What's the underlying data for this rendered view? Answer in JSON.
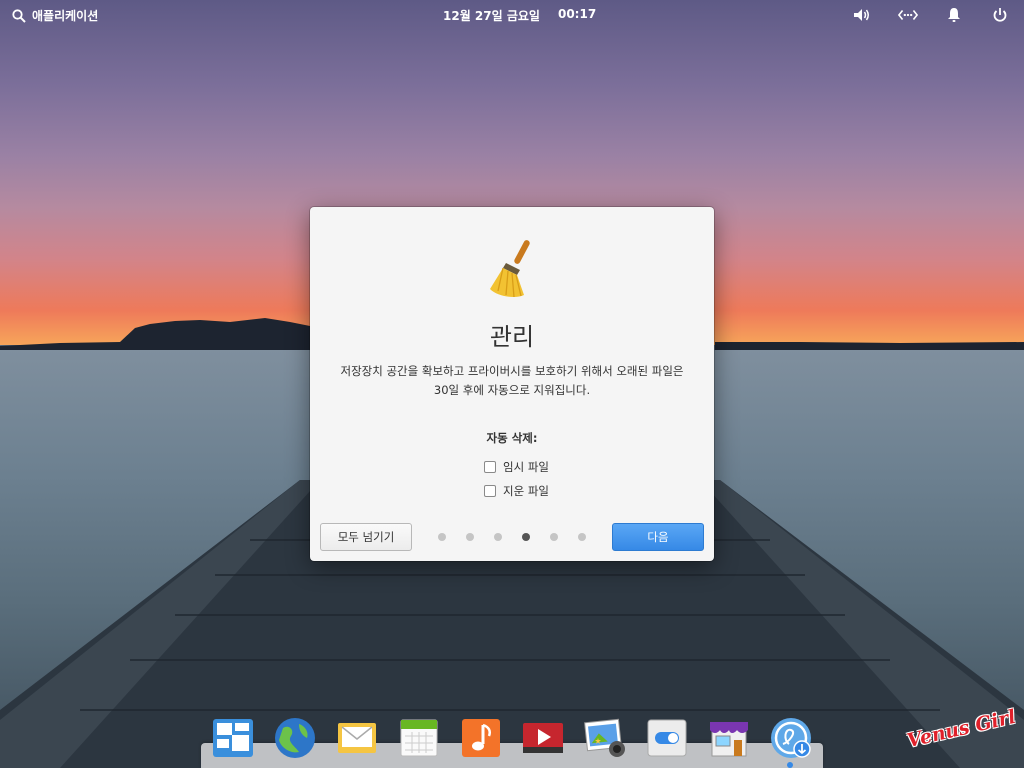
{
  "panel": {
    "applications_label": "애플리케이션",
    "date": "12월 27일 금요일",
    "time": "00:17"
  },
  "dialog": {
    "title": "관리",
    "description": "저장장치 공간을 확보하고 프라이버시를 보호하기 위해서 오래된 파일은 30일 후에 자동으로 지워집니다.",
    "auto_delete_label": "자동 삭제:",
    "options": [
      {
        "label": "임시 파일",
        "checked": false
      },
      {
        "label": "지운 파일",
        "checked": false
      }
    ],
    "skip_button": "모두 넘기기",
    "next_button": "다음",
    "page_count": 6,
    "current_page": 4
  },
  "dock": {
    "apps": [
      "multitasking-view-icon",
      "web-browser-icon",
      "mail-icon",
      "calendar-icon",
      "music-icon",
      "videos-icon",
      "photos-icon",
      "system-settings-icon",
      "appcenter-icon",
      "installer-icon"
    ]
  },
  "watermark": "Venus Girl",
  "colors": {
    "accent": "#3689e6",
    "dialog_bg": "#f5f5f5",
    "panel_text": "#ffffff"
  }
}
